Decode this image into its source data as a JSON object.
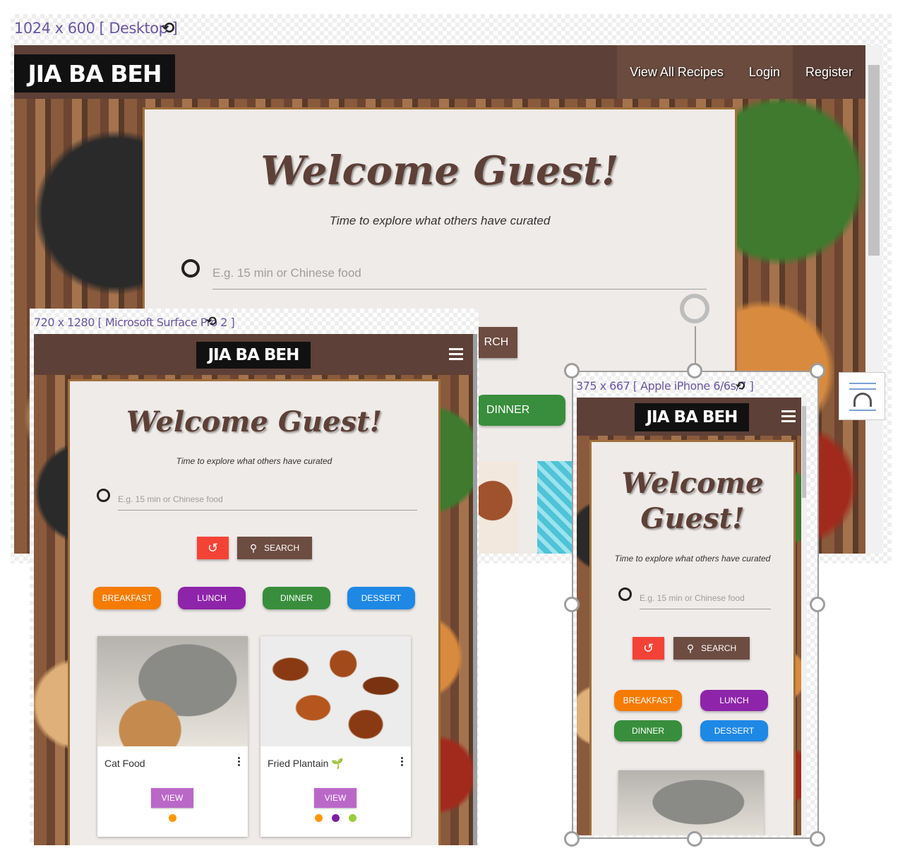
{
  "desktop": {
    "label": "1024 x 600 [ Desktop ]",
    "logo": "JIA BA BEH",
    "nav": [
      "View All Recipes",
      "Login",
      "Register"
    ],
    "welcome": "Welcome Guest!",
    "subtitle": "Time to explore what others have curated",
    "search_placeholder": "E.g. 15 min or Chinese food",
    "search_button_partial": "RCH",
    "dinner_partial": "DINNER"
  },
  "tablet": {
    "label": "720 x 1280 [ Microsoft Surface Pro 2 ]",
    "logo": "JIA BA BEH",
    "welcome": "Welcome Guest!",
    "subtitle": "Time to explore what others have curated",
    "search_placeholder": "E.g. 15 min or Chinese food",
    "search_label": "SEARCH",
    "categories": [
      {
        "label": "BREAKFAST",
        "color": "#f57c00"
      },
      {
        "label": "LUNCH",
        "color": "#8e24aa"
      },
      {
        "label": "DINNER",
        "color": "#388e3c"
      },
      {
        "label": "DESSERT",
        "color": "#1e88e5"
      }
    ],
    "recipes": [
      {
        "name": "Cat Food",
        "view": "VIEW",
        "dots": [
          "#ff9800"
        ]
      },
      {
        "name": "Fried Plantain",
        "view": "VIEW",
        "dots": [
          "#ff9800",
          "#7b1fa2",
          "#9ccc3c"
        ]
      }
    ]
  },
  "phone": {
    "label": "375 x 667 [ Apple iPhone 6/6s/7 ]",
    "logo": "JIA BA BEH",
    "welcome_line1": "Welcome",
    "welcome_line2": "Guest!",
    "subtitle": "Time to explore what others have curated",
    "search_placeholder": "E.g. 15 min or Chinese food",
    "search_label": "SEARCH",
    "categories": [
      {
        "label": "BREAKFAST",
        "color": "#f57c00"
      },
      {
        "label": "LUNCH",
        "color": "#8e24aa"
      },
      {
        "label": "DINNER",
        "color": "#388e3c"
      },
      {
        "label": "DESSERT",
        "color": "#1e88e5"
      }
    ]
  },
  "colors": {
    "navbar": "#5d4037",
    "card": "#efebe9",
    "accent_purple": "#6a56a0"
  }
}
